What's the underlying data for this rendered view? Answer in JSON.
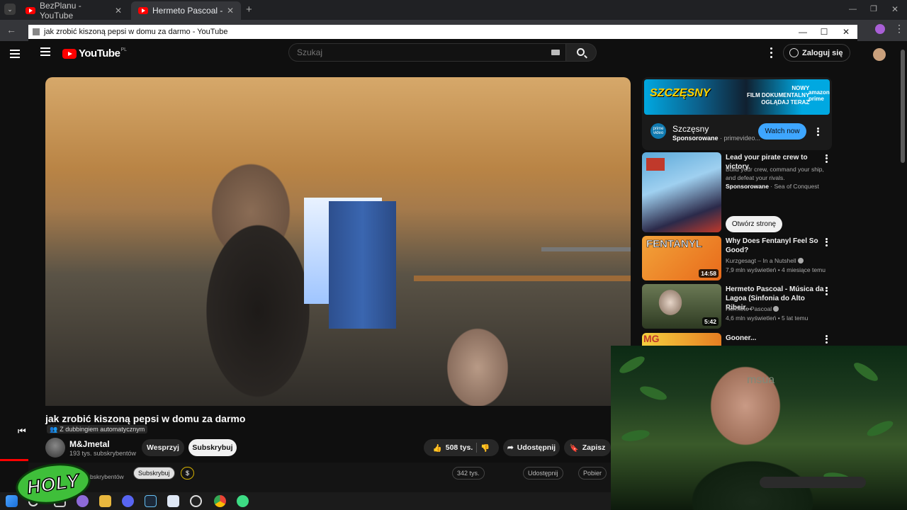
{
  "browser": {
    "tabs": [
      {
        "title": "BezPlanu - YouTube",
        "active": false
      },
      {
        "title": "Hermeto Pascoal - Música da L",
        "active": true
      }
    ],
    "new_tab": "+"
  },
  "popup": {
    "title": "jak zrobić kiszoną pepsi w domu za darmo - YouTube"
  },
  "masthead": {
    "logo": "YouTube",
    "region": "PL",
    "search_placeholder": "Szukaj",
    "signin": "Zaloguj się"
  },
  "video": {
    "title": "jak zrobić kiszoną pepsi w domu za darmo",
    "dubbing": "Z dubbingiem automatycznym",
    "channel": "M&Jmetal",
    "subscribers": "193 tys. subskrybentów",
    "support": "Wesprzyj",
    "subscribe": "Subskrybuj",
    "likes": "508 tys.",
    "share": "Udostępnij",
    "save": "Zapisz"
  },
  "ghost_row": {
    "subscribers_fragment": "subskrybentów",
    "subscribe": "Subskrybuj",
    "dollar": "$",
    "likes": "342 tys.",
    "share": "Udostępnij",
    "download": "Pobier"
  },
  "sidebar": {
    "ad": {
      "banner_logo": "SZCZĘSNY",
      "banner_tagline": "NOWY\nFILM DOKUMENTALNY\nOGLĄDAJ TERAZ",
      "banner_brand": "amazon\nprime",
      "icon_text": "prime video",
      "name": "Szczęsny",
      "sponsored": "Sponsorowane",
      "domain": "primevideo...",
      "cta": "Watch now"
    },
    "promo": {
      "title": "Lead your pirate crew to victory.",
      "desc": "Build your crew, command your ship, and defeat your rivals.",
      "sponsored": "Sponsorowane",
      "advertiser": "Sea of Conquest",
      "cta": "Otwórz stronę"
    },
    "recs": [
      {
        "title": "Why Does Fentanyl Feel So Good?",
        "channel": "Kurzgesagt – In a Nutshell",
        "meta": "7,9 mln wyświetleń • 4 miesiące temu",
        "duration": "14:58",
        "thumb_text": "FENTANYL"
      },
      {
        "title": "Hermeto Pascoal - Música da Lagoa (Sinfonia do Alto Ribeir...",
        "channel": "Hermeto Pascoal",
        "meta": "4,6 mln wyświetleń • 5 lat temu",
        "duration": "5:42"
      },
      {
        "title": "Gooner...",
        "channel": "",
        "meta": "",
        "duration": "",
        "thumb_text": "MG"
      }
    ]
  },
  "webcam": {
    "sign_text": "msua"
  },
  "overlay": {
    "logo_text": "HOLY"
  },
  "colors": {
    "youtube_red": "#ff0000",
    "cta_blue": "#3ea6ff",
    "prime_blue": "#00a8e1",
    "holy_green": "#3fbf3a"
  }
}
